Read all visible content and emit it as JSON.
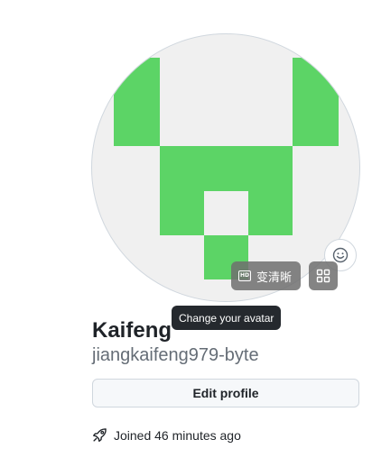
{
  "profile": {
    "display_name": "Kaifeng",
    "username": "jiangkaifeng979-byte",
    "edit_label": "Edit profile",
    "joined_text": "Joined 46 minutes ago"
  },
  "avatar": {
    "tooltip": "Change your avatar",
    "identicon_color": "#5cd466",
    "background_color": "#f0f0f0"
  },
  "overlay": {
    "hd_badge": "HD",
    "hd_label": "变清晰"
  },
  "icons": {
    "emoji": "smiley-icon",
    "grid": "grid-icon",
    "joined": "rocket-icon"
  }
}
